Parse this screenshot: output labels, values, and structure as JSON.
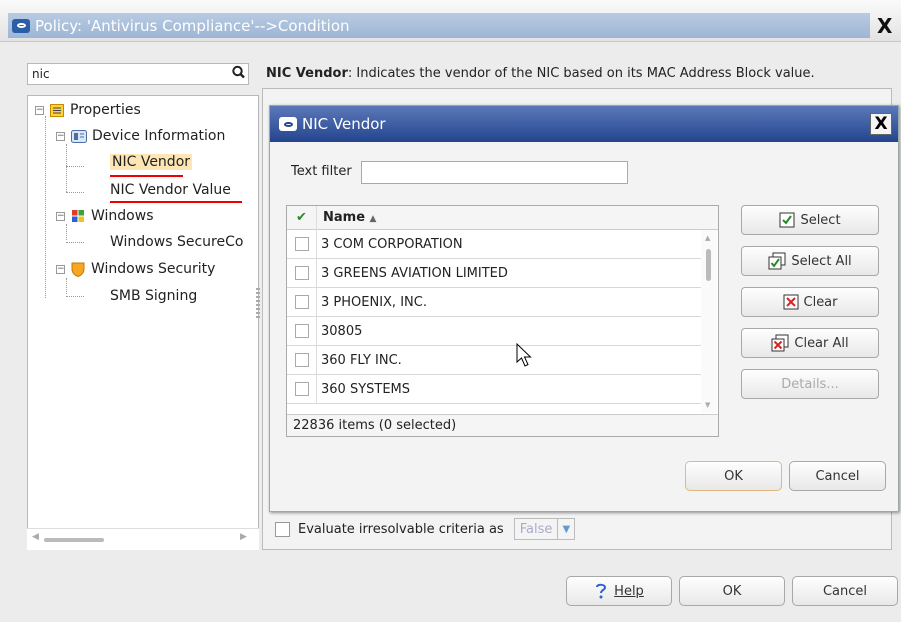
{
  "window": {
    "title": "Policy: 'Antivirus Compliance'-->Condition",
    "close": "X"
  },
  "search": {
    "value": "nic"
  },
  "tree": {
    "root": "Properties",
    "group1": "Device Information",
    "item1": "NIC Vendor",
    "item2": "NIC Vendor Value",
    "group2": "Windows",
    "item3": "Windows SecureCo",
    "group3": "Windows Security",
    "item4": "SMB Signing"
  },
  "description": {
    "field": "NIC Vendor",
    "text": ": Indicates the vendor of the NIC based on its MAC Address Block value."
  },
  "evaluate": {
    "label": "Evaluate irresolvable criteria as",
    "value": "False"
  },
  "bottom_buttons": {
    "help": "Help",
    "ok": "OK",
    "cancel": "Cancel"
  },
  "dialog": {
    "title": "NIC Vendor",
    "close": "X",
    "text_filter_label": "Text filter",
    "text_filter_value": "",
    "column_name": "Name",
    "rows": [
      "3 COM CORPORATION",
      "3 GREENS AVIATION LIMITED",
      "3 PHOENIX, INC.",
      "30805",
      "360 FLY INC.",
      "360 SYSTEMS"
    ],
    "status": "22836 items (0 selected)",
    "buttons": {
      "select": "Select",
      "select_all": "Select All",
      "clear": "Clear",
      "clear_all": "Clear All",
      "details": "Details...",
      "ok": "OK",
      "cancel": "Cancel"
    }
  },
  "colors": {
    "dialog_title_bg": "#24448f",
    "highlight": "#fde5b4",
    "underline_red": "#e00000"
  }
}
